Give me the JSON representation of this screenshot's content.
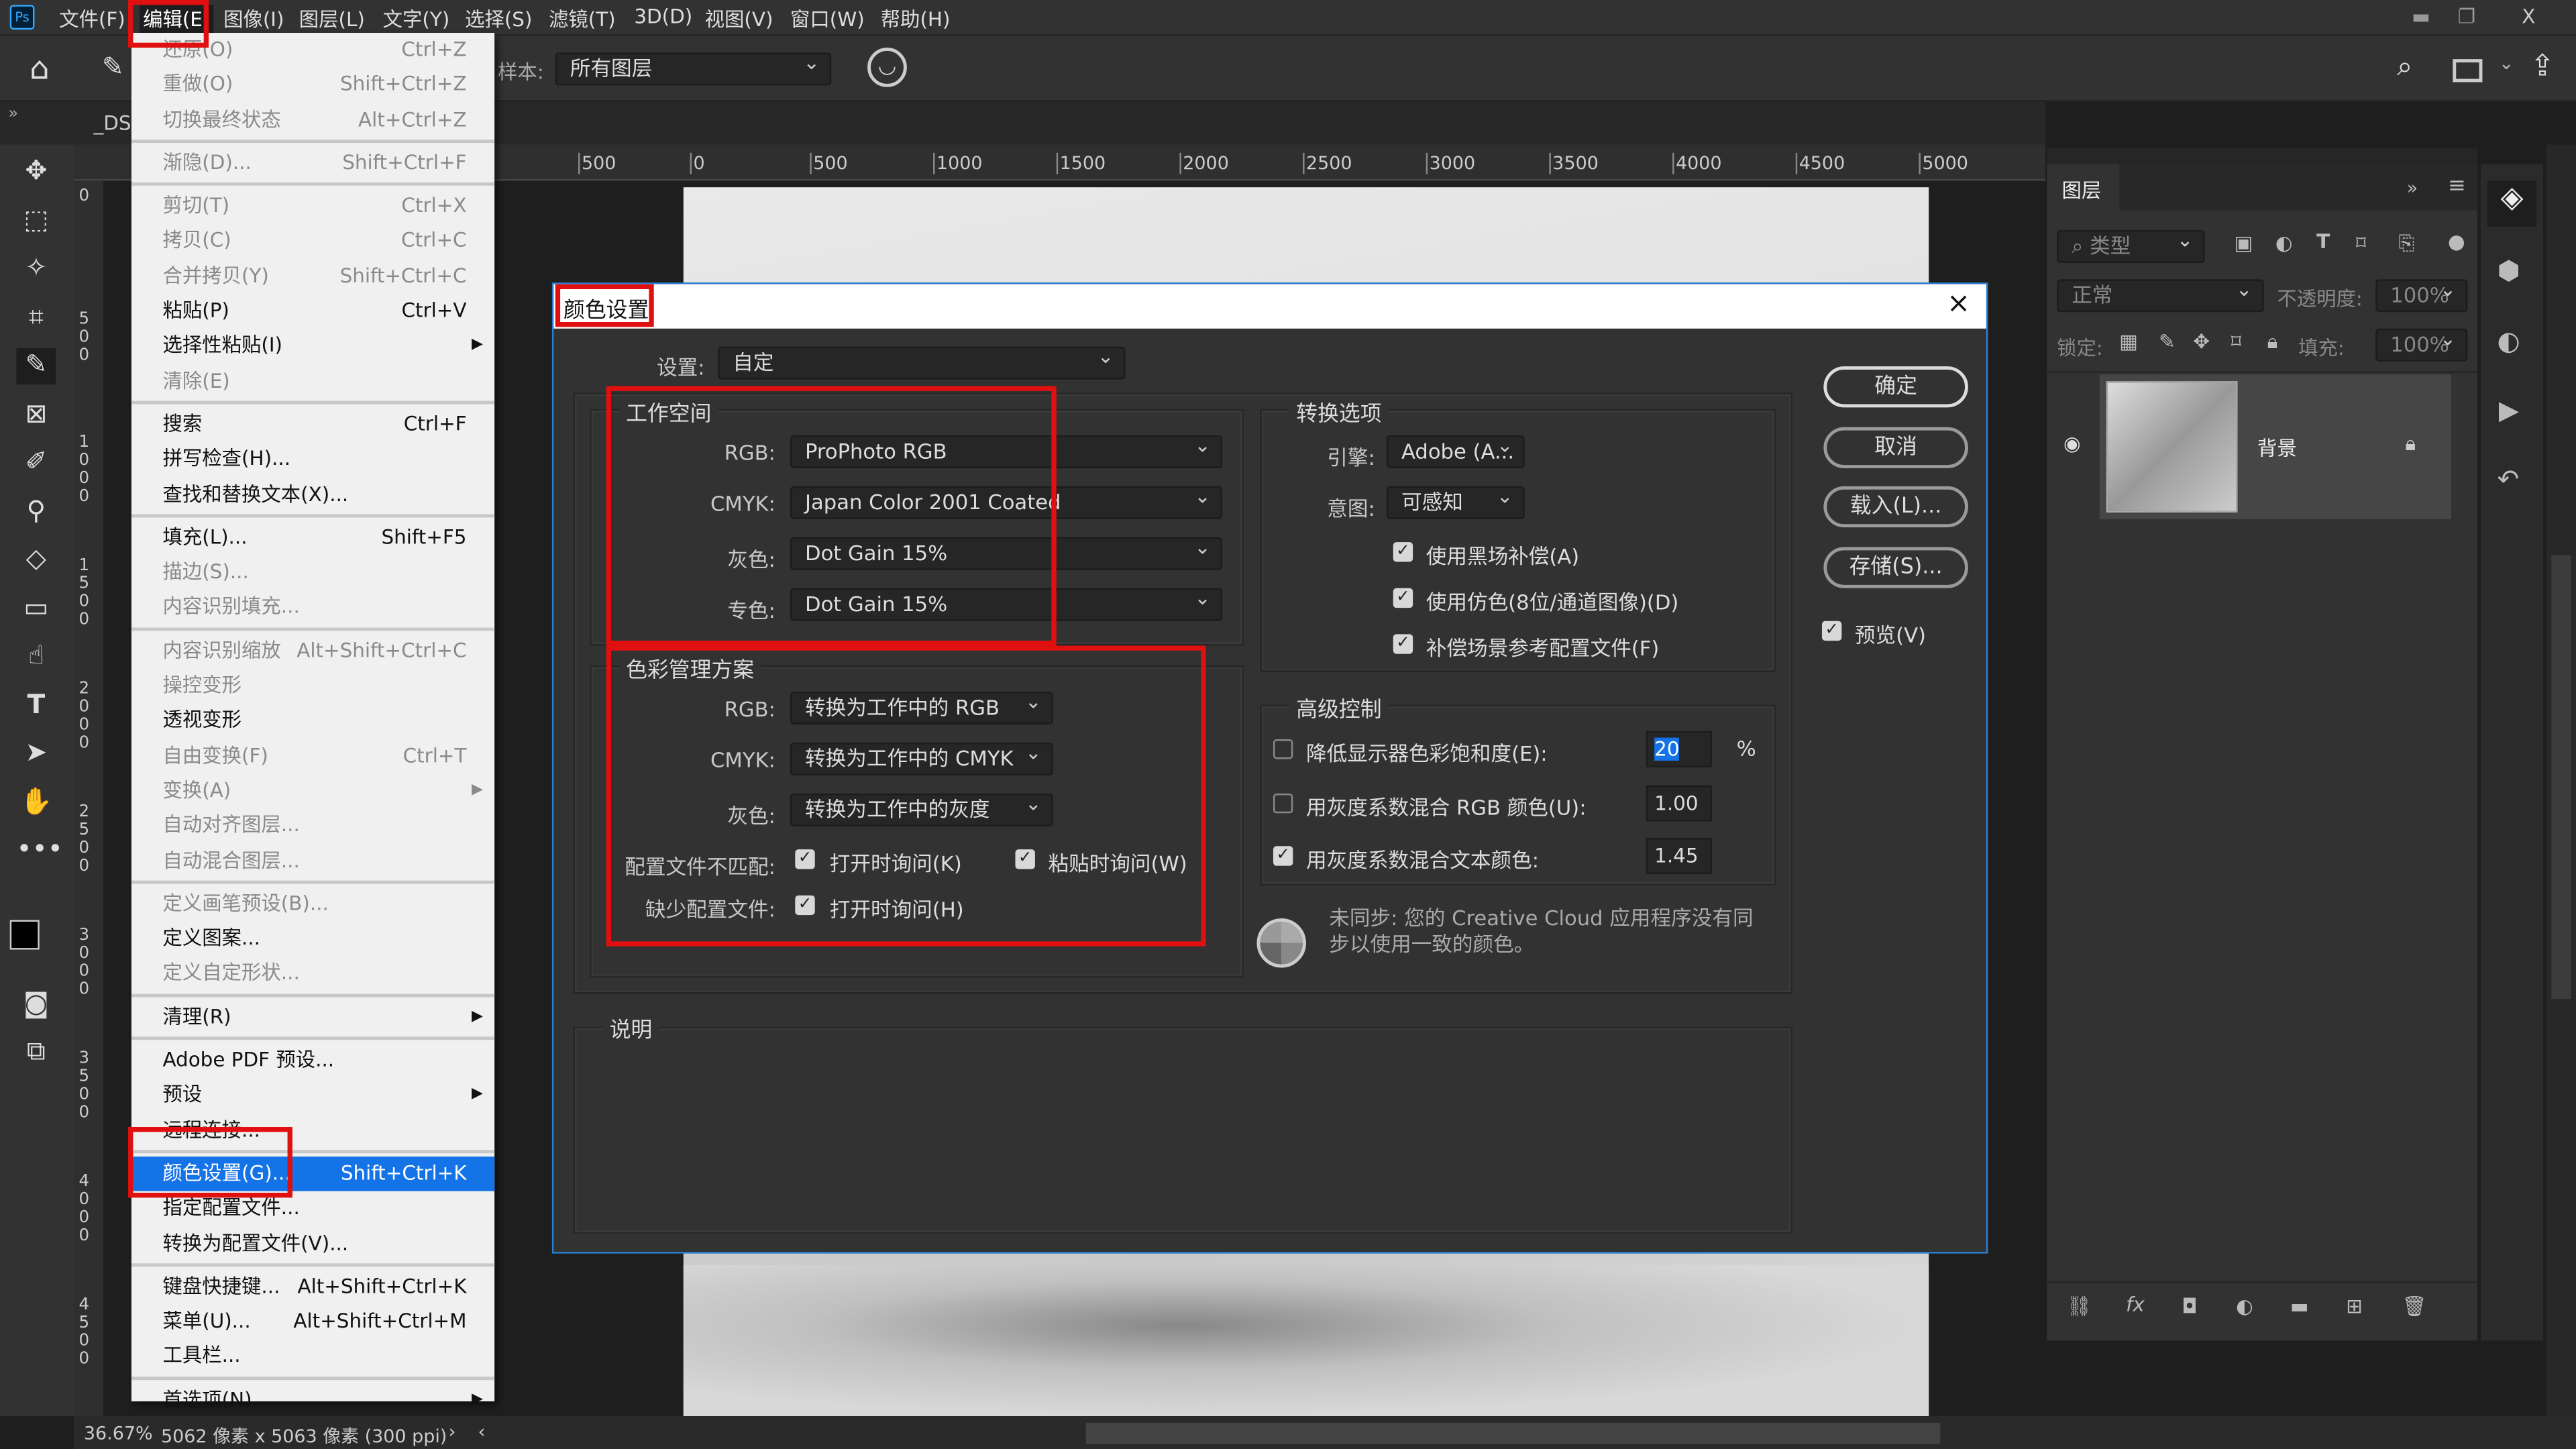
{
  "app": {
    "logo": "Ps",
    "window_controls": {
      "minimize": "▬",
      "restore": "❐",
      "close": "X"
    }
  },
  "menubar": [
    "文件(F)",
    "编辑(E)",
    "图像(I)",
    "图层(L)",
    "文字(Y)",
    "选择(S)",
    "滤镜(T)",
    "3D(D)",
    "视图(V)",
    "窗口(W)",
    "帮助(H)"
  ],
  "options": {
    "sample_label": "样本:",
    "sample_value": "所有图层"
  },
  "document_tab": "_DSC",
  "ruler_h": [
    "500",
    "0",
    "500",
    "1000",
    "1500",
    "2000",
    "2500",
    "3000",
    "3500",
    "4000",
    "4500",
    "5000"
  ],
  "ruler_v": [
    "0",
    "500",
    "1000",
    "1500",
    "2000",
    "2500",
    "3000",
    "3500",
    "4000",
    "4500"
  ],
  "edit_menu": [
    {
      "label": "还原(O)",
      "shortcut": "Ctrl+Z",
      "disabled": true
    },
    {
      "label": "重做(O)",
      "shortcut": "Shift+Ctrl+Z",
      "disabled": true
    },
    {
      "label": "切换最终状态",
      "shortcut": "Alt+Ctrl+Z",
      "disabled": true
    },
    {
      "sep": true
    },
    {
      "label": "渐隐(D)...",
      "shortcut": "Shift+Ctrl+F",
      "disabled": true
    },
    {
      "sep": true
    },
    {
      "label": "剪切(T)",
      "shortcut": "Ctrl+X",
      "disabled": true
    },
    {
      "label": "拷贝(C)",
      "shortcut": "Ctrl+C",
      "disabled": true
    },
    {
      "label": "合并拷贝(Y)",
      "shortcut": "Shift+Ctrl+C",
      "disabled": true
    },
    {
      "label": "粘贴(P)",
      "shortcut": "Ctrl+V"
    },
    {
      "label": "选择性粘贴(I)",
      "submenu": true
    },
    {
      "label": "清除(E)",
      "disabled": true
    },
    {
      "sep": true
    },
    {
      "label": "搜索",
      "shortcut": "Ctrl+F"
    },
    {
      "label": "拼写检查(H)..."
    },
    {
      "label": "查找和替换文本(X)..."
    },
    {
      "sep": true
    },
    {
      "label": "填充(L)...",
      "shortcut": "Shift+F5"
    },
    {
      "label": "描边(S)...",
      "disabled": true
    },
    {
      "label": "内容识别填充...",
      "disabled": true
    },
    {
      "sep": true
    },
    {
      "label": "内容识别缩放",
      "shortcut": "Alt+Shift+Ctrl+C",
      "disabled": true
    },
    {
      "label": "操控变形",
      "disabled": true
    },
    {
      "label": "透视变形"
    },
    {
      "label": "自由变换(F)",
      "shortcut": "Ctrl+T",
      "disabled": true
    },
    {
      "label": "变换(A)",
      "submenu": true,
      "disabled": true
    },
    {
      "label": "自动对齐图层...",
      "disabled": true
    },
    {
      "label": "自动混合图层...",
      "disabled": true
    },
    {
      "sep": true
    },
    {
      "label": "定义画笔预设(B)...",
      "disabled": true
    },
    {
      "label": "定义图案..."
    },
    {
      "label": "定义自定形状...",
      "disabled": true
    },
    {
      "sep": true
    },
    {
      "label": "清理(R)",
      "submenu": true
    },
    {
      "sep": true
    },
    {
      "label": "Adobe PDF 预设..."
    },
    {
      "label": "预设",
      "submenu": true
    },
    {
      "label": "远程连接..."
    },
    {
      "sep": true
    },
    {
      "label": "颜色设置(G)...",
      "shortcut": "Shift+Ctrl+K",
      "highlighted": true
    },
    {
      "label": "指定配置文件..."
    },
    {
      "label": "转换为配置文件(V)..."
    },
    {
      "sep": true
    },
    {
      "label": "键盘快捷键...",
      "shortcut": "Alt+Shift+Ctrl+K"
    },
    {
      "label": "菜单(U)...",
      "shortcut": "Alt+Shift+Ctrl+M"
    },
    {
      "label": "工具栏..."
    },
    {
      "sep": true
    },
    {
      "label": "首选项(N)",
      "submenu": true
    }
  ],
  "dialog": {
    "title": "颜色设置",
    "close": "×",
    "settings_label": "设置:",
    "settings_value": "自定",
    "workspace": {
      "legend": "工作空间",
      "rgb_label": "RGB:",
      "rgb": "ProPhoto RGB",
      "cmyk_label": "CMYK:",
      "cmyk": "Japan Color 2001 Coated",
      "gray_label": "灰色:",
      "gray": "Dot Gain 15%",
      "spot_label": "专色:",
      "spot": "Dot Gain 15%"
    },
    "policies": {
      "legend": "色彩管理方案",
      "rgb_label": "RGB:",
      "rgb": "转换为工作中的 RGB",
      "cmyk_label": "CMYK:",
      "cmyk": "转换为工作中的 CMYK",
      "gray_label": "灰色:",
      "gray": "转换为工作中的灰度",
      "mismatch_label": "配置文件不匹配:",
      "mismatch_open": "打开时询问(K)",
      "mismatch_paste": "粘贴时询问(W)",
      "missing_label": "缺少配置文件:",
      "missing_open": "打开时询问(H)"
    },
    "conversion": {
      "legend": "转换选项",
      "engine_label": "引擎:",
      "engine": "Adobe (A...",
      "intent_label": "意图:",
      "intent": "可感知",
      "bpc": "使用黑场补偿(A)",
      "dither": "使用仿色(8位/通道图像)(D)",
      "scene": "补偿场景参考配置文件(F)"
    },
    "advanced": {
      "legend": "高级控制",
      "desaturate": "降低显示器色彩饱和度(E):",
      "desaturate_value": "20",
      "percent": "%",
      "blend_rgb": "用灰度系数混合 RGB 颜色(U):",
      "blend_rgb_value": "1.00",
      "blend_text": "用灰度系数混合文本颜色:",
      "blend_text_value": "1.45"
    },
    "sync_message": "未同步: 您的 Creative Cloud 应用程序没有同步以使用一致的颜色。",
    "description_legend": "说明",
    "buttons": {
      "ok": "确定",
      "cancel": "取消",
      "load": "载入(L)...",
      "save": "存储(S)..."
    },
    "preview": "预览(V)"
  },
  "layers_panel": {
    "tab": "图层",
    "filter": "类型",
    "blend_mode": "正常",
    "opacity_label": "不透明度:",
    "opacity": "100%",
    "lock_label": "锁定:",
    "fill_label": "填充:",
    "fill": "100%",
    "layer_name": "背景"
  },
  "status": {
    "zoom": "36.67%",
    "doc_info": "5062 像素 x 5063 像素 (300 ppi)",
    "arrow": "›",
    "scroll_left": "‹"
  },
  "colors": {
    "highlight": "#1473e6",
    "annotation_red": "#e01010",
    "dialog_border": "#2a7fd4"
  }
}
